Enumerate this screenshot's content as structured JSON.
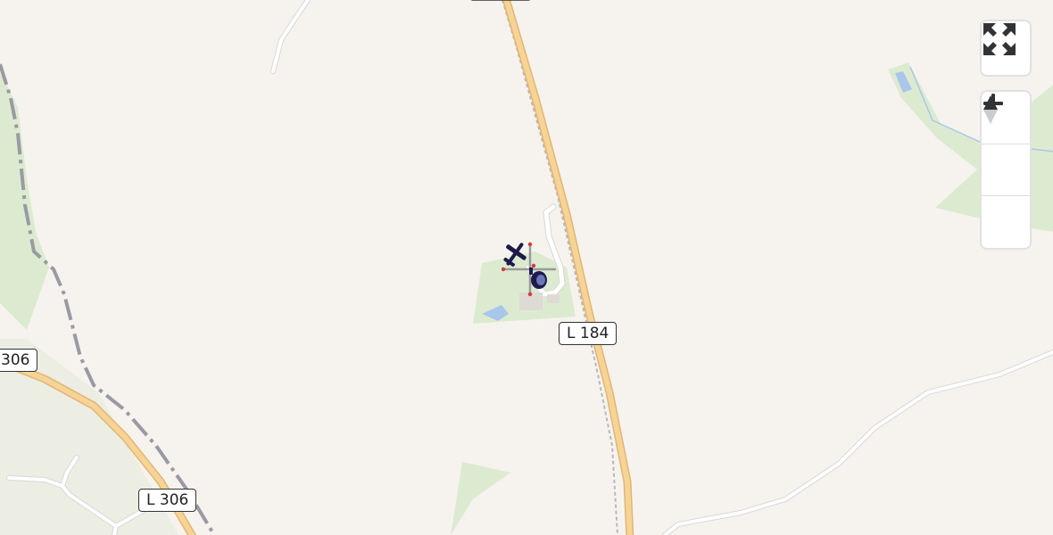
{
  "map": {
    "road_labels": [
      {
        "id": "l184",
        "text": "L 184"
      },
      {
        "id": "l306-left",
        "text": "306"
      },
      {
        "id": "l306-bottom",
        "text": "L 306"
      }
    ],
    "colors": {
      "background": "#f6f3ef",
      "forest": "#dcebd0",
      "water": "#aac6ea",
      "primary_road": "#f2cd8c",
      "railway": "#9a9aa3"
    }
  },
  "markers": [
    {
      "type": "airplane",
      "icon": "airplane-icon",
      "color": "#1e1a4b"
    },
    {
      "type": "helicopter",
      "icon": "helicopter-icon",
      "color": "#1e1a4b"
    }
  ],
  "controls": {
    "fullscreen": {
      "icon": "fullscreen-icon"
    },
    "zoom_in": {
      "icon": "plus-icon"
    },
    "zoom_out": {
      "icon": "minus-icon"
    },
    "compass": {
      "icon": "compass-icon"
    }
  }
}
